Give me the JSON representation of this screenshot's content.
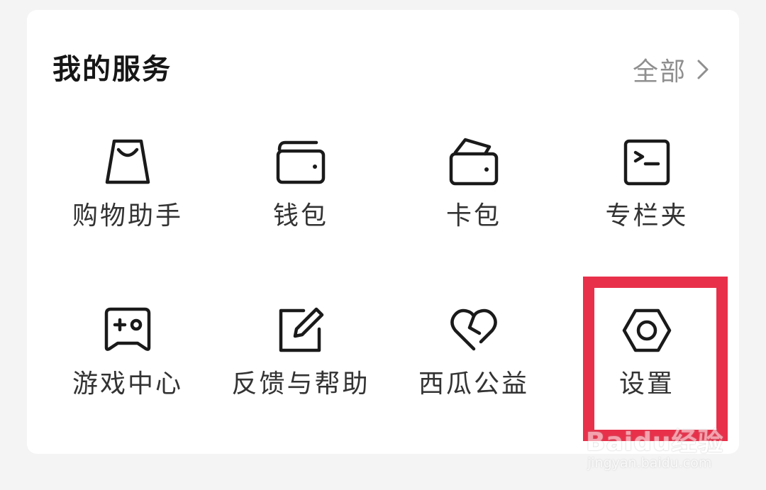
{
  "section": {
    "title": "我的服务",
    "all_label": "全部"
  },
  "services": [
    {
      "label": "购物助手",
      "icon": "shopping-bag-icon"
    },
    {
      "label": "钱包",
      "icon": "wallet-icon"
    },
    {
      "label": "卡包",
      "icon": "card-holder-icon"
    },
    {
      "label": "专栏夹",
      "icon": "column-folder-icon"
    },
    {
      "label": "游戏中心",
      "icon": "gamepad-icon"
    },
    {
      "label": "反馈与帮助",
      "icon": "edit-feedback-icon"
    },
    {
      "label": "西瓜公益",
      "icon": "heart-icon"
    },
    {
      "label": "设置",
      "icon": "hex-nut-settings-icon"
    }
  ],
  "highlight_color": "#e8304a",
  "watermark": {
    "main": "Baidu经验",
    "sub": "jingyan.baidu.com"
  }
}
